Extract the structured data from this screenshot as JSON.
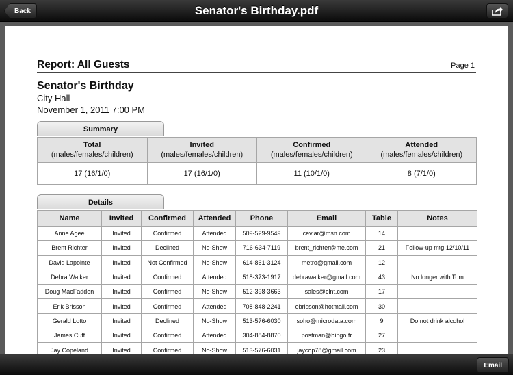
{
  "navbar": {
    "title": "Senator's Birthday.pdf",
    "back_label": "Back"
  },
  "report": {
    "title": "Report: All Guests",
    "page_label": "Page 1",
    "event_name": "Senator's Birthday",
    "venue": "City Hall",
    "date": "November 1, 2011 7:00 PM"
  },
  "summary": {
    "tab_label": "Summary",
    "headers": [
      {
        "title": "Total",
        "sub": "(males/females/children)"
      },
      {
        "title": "Invited",
        "sub": "(males/females/children)"
      },
      {
        "title": "Confirmed",
        "sub": "(males/females/children)"
      },
      {
        "title": "Attended",
        "sub": "(males/females/children)"
      }
    ],
    "values": [
      "17 (16/1/0)",
      "17 (16/1/0)",
      "11 (10/1/0)",
      "8 (7/1/0)"
    ]
  },
  "details": {
    "tab_label": "Details",
    "columns": [
      "Name",
      "Invited",
      "Confirmed",
      "Attended",
      "Phone",
      "Email",
      "Table",
      "Notes"
    ],
    "rows": [
      [
        "Anne Agee",
        "Invited",
        "Confirmed",
        "Attended",
        "509-529-9549",
        "cevlar@msn.com",
        "14",
        ""
      ],
      [
        "Brent Richter",
        "Invited",
        "Declined",
        "No-Show",
        "716-634-7119",
        "brent_richter@me.com",
        "21",
        "Follow-up mtg 12/10/11"
      ],
      [
        "David Lapointe",
        "Invited",
        "Not Confirmed",
        "No-Show",
        "614-861-3124",
        "metro@gmail.com",
        "12",
        ""
      ],
      [
        "Debra Walker",
        "Invited",
        "Confirmed",
        "Attended",
        "518-373-1917",
        "debrawalker@gmail.com",
        "43",
        "No longer with Tom"
      ],
      [
        "Doug MacFadden",
        "Invited",
        "Confirmed",
        "No-Show",
        "512-398-3663",
        "sales@clnt.com",
        "17",
        ""
      ],
      [
        "Erik Brisson",
        "Invited",
        "Confirmed",
        "Attended",
        "708-848-2241",
        "ebrisson@hotmail.com",
        "30",
        ""
      ],
      [
        "Gerald Lotto",
        "Invited",
        "Declined",
        "No-Show",
        "513-576-6030",
        "soho@microdata.com",
        "9",
        "Do not drink alcohol"
      ],
      [
        "James Cuff",
        "Invited",
        "Confirmed",
        "Attended",
        "304-884-8870",
        "postman@bingo.fr",
        "27",
        ""
      ],
      [
        "Jay Copeland",
        "Invited",
        "Confirmed",
        "No-Show",
        "513-576-6031",
        "jaycop78@gmail.com",
        "23",
        ""
      ]
    ]
  },
  "toolbar": {
    "email_label": "Email"
  },
  "icons": {
    "share": "share-icon"
  }
}
